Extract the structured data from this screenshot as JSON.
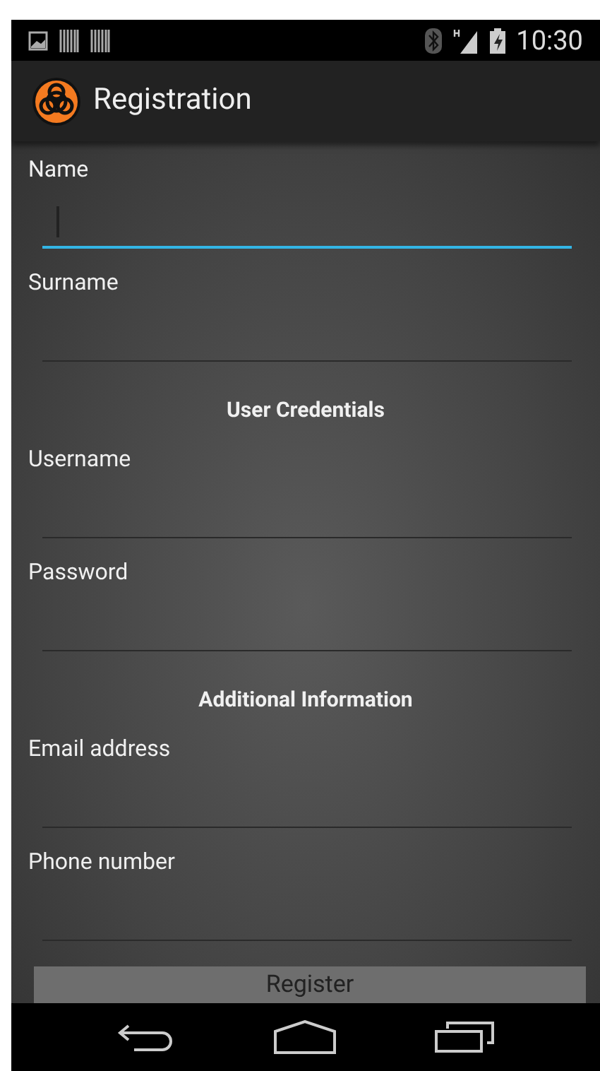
{
  "status_bar": {
    "time": "10:30"
  },
  "action_bar": {
    "title": "Registration"
  },
  "form": [
    {
      "kind": "field",
      "label": "Name",
      "focused": true
    },
    {
      "kind": "field",
      "label": "Surname",
      "focused": false
    },
    {
      "kind": "section",
      "title": "User Credentials"
    },
    {
      "kind": "field",
      "label": "Username",
      "focused": false
    },
    {
      "kind": "field",
      "label": "Password",
      "focused": false
    },
    {
      "kind": "section",
      "title": "Additional Information"
    },
    {
      "kind": "field",
      "label": "Email address",
      "focused": false
    },
    {
      "kind": "field",
      "label": "Phone number",
      "focused": false
    }
  ],
  "button": {
    "label": "Register"
  }
}
